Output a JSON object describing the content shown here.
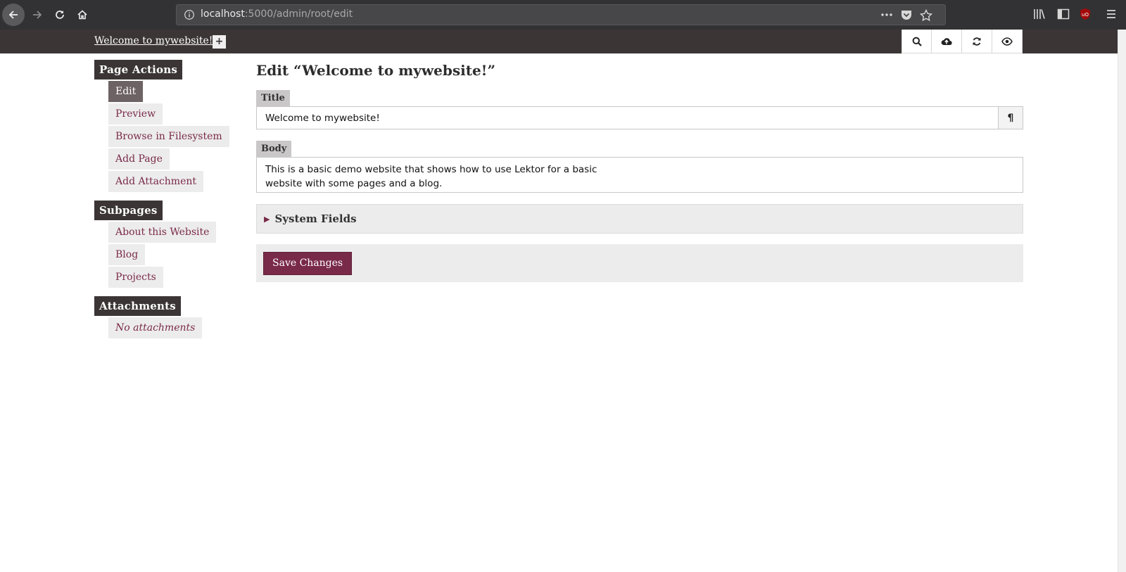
{
  "browser": {
    "url_host": "localhost",
    "url_rest": ":5000/admin/root/edit"
  },
  "header": {
    "site_link": "Welcome to mywebsite!",
    "add_label": "+"
  },
  "sidebar": {
    "page_actions": {
      "heading": "Page Actions",
      "items": [
        "Edit",
        "Preview",
        "Browse in Filesystem",
        "Add Page",
        "Add Attachment"
      ]
    },
    "subpages": {
      "heading": "Subpages",
      "items": [
        "About this Website",
        "Blog",
        "Projects"
      ]
    },
    "attachments": {
      "heading": "Attachments",
      "empty": "No attachments"
    }
  },
  "main": {
    "title": "Edit “Welcome to mywebsite!”",
    "title_field": {
      "label": "Title",
      "value": "Welcome to mywebsite!",
      "para_icon": "¶"
    },
    "body_field": {
      "label": "Body",
      "value": "This is a basic demo website that shows how to use Lektor for a basic\nwebsite with some pages and a blog."
    },
    "system_fields": {
      "arrow": "▶",
      "label": "System Fields"
    },
    "save_label": "Save Changes"
  },
  "colors": {
    "accent": "#7a2a49",
    "header_bg": "#3b3536",
    "panel_bg": "#ececec"
  }
}
